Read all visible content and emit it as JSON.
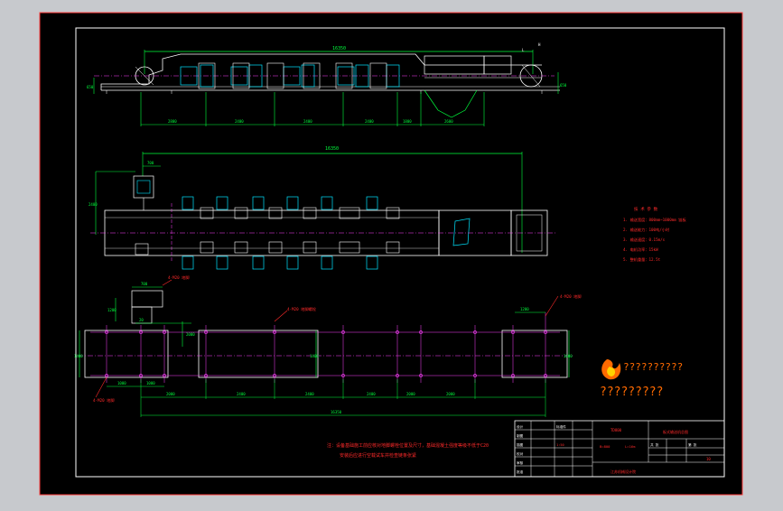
{
  "drawing": {
    "colors": {
      "background": "#000000",
      "frame": "#ffffff",
      "outer_border": "#ff3b3b",
      "dimension": "#00ff3c",
      "outline": "#ffffff",
      "centerline": "#ff40ff",
      "part": "#00e5ff",
      "note": "#ff2a2a",
      "watermark": "#ff6a00"
    },
    "elevation_dims": {
      "overall": "16350",
      "left_height": "650",
      "right_height": "650",
      "segments": [
        "2800",
        "2400",
        "2400",
        "2400",
        "1800",
        "2600"
      ]
    },
    "plan_dims": {
      "overall": "16350",
      "motor_width": "700",
      "side": "2400",
      "inner": "1500"
    },
    "foundation_dims": {
      "tag_top": "4-M20 地脚",
      "tag_mid": "4-M20 地脚螺栓",
      "tag_right": "4-M20 地脚",
      "tag_left": "4-M20 地脚",
      "block_w": "700",
      "block_h": "1200",
      "rise": "2000",
      "left_height": "1400",
      "mid_height": "1400",
      "right_height": "1000",
      "right_top": "1200",
      "bottom_left": "1000",
      "bottom_left2": "1000",
      "segments": [
        "2000",
        "2400",
        "2400",
        "2400",
        "2000",
        "2000"
      ],
      "overall": "16350"
    },
    "tech_notes": {
      "heading": "技 术 参 数",
      "lines": [
        "1. 输送宽度：800mm~1000mm 链板",
        "2. 输送能力：100吨/小时",
        "3. 输送速度：0.15m/s",
        "4. 电机功率：15kW",
        "5. 整机重量：12.5t"
      ]
    },
    "general_note": {
      "line1": "注：设备基础施工前应核对地脚螺栓位置及尺寸，基础混凝土强度等级不低于C20",
      "line2": "安装后应进行空载试车并检查链条张紧"
    },
    "watermark": {
      "line1": "??????????",
      "line2": "?????????"
    },
    "title_block": {
      "left_rows": [
        "设计",
        "制图",
        "描图",
        "校对",
        "审核",
        "批准"
      ],
      "col2": [
        "",
        "",
        "",
        "",
        "",
        ""
      ],
      "material": "标准件",
      "model": "TD800",
      "model2": "B=800",
      "model3": "L=16m",
      "scale": "1:50",
      "title": "板式输送机总图",
      "sheet_label": "共 张",
      "sheet_label2": "第 张",
      "sheet_no": "10",
      "company": "江苏机械设计院"
    }
  }
}
